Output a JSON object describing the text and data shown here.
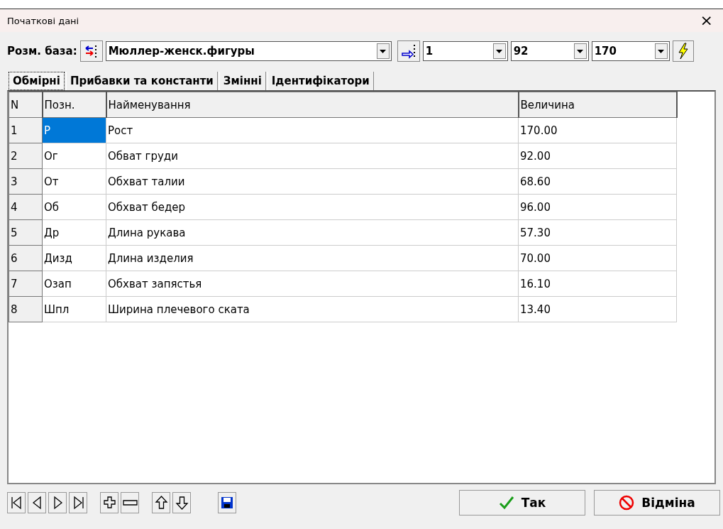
{
  "window": {
    "title": "Початкові дані",
    "close": "×"
  },
  "toolbar": {
    "label": "Розм. база:",
    "base": "Мюллер-женск.фигуры",
    "combos": [
      "1",
      "92",
      "170"
    ]
  },
  "tabs": [
    {
      "label": "Обмірні",
      "selected": true
    },
    {
      "label": "Прибавки та константи",
      "selected": false
    },
    {
      "label": "Змінні",
      "selected": false
    },
    {
      "label": "Ідентифікатори",
      "selected": false
    }
  ],
  "table": {
    "columns": [
      "N",
      "Позн.",
      "Найменування",
      "Величина"
    ],
    "rows": [
      {
        "n": "1",
        "code": "Р",
        "name": "Рост",
        "value": "170.00",
        "selected": true
      },
      {
        "n": "2",
        "code": "Ог",
        "name": "Обват груди",
        "value": "92.00",
        "selected": false
      },
      {
        "n": "3",
        "code": "От",
        "name": "Обхват талии",
        "value": "68.60",
        "selected": false
      },
      {
        "n": "4",
        "code": "Об",
        "name": "Обхват бедер",
        "value": "96.00",
        "selected": false
      },
      {
        "n": "5",
        "code": "Др",
        "name": "Длина рукава",
        "value": "57.30",
        "selected": false
      },
      {
        "n": "6",
        "code": "Дизд",
        "name": "Длина изделия",
        "value": "70.00",
        "selected": false
      },
      {
        "n": "7",
        "code": "Озап",
        "name": "Обхват запястья",
        "value": "16.10",
        "selected": false
      },
      {
        "n": "8",
        "code": "Шпл",
        "name": "Ширина плечевого ската",
        "value": "13.40",
        "selected": false
      }
    ]
  },
  "buttons": [
    {
      "kind": "ok",
      "label": "Так"
    },
    {
      "kind": "cancel",
      "label": "Відміна"
    }
  ]
}
